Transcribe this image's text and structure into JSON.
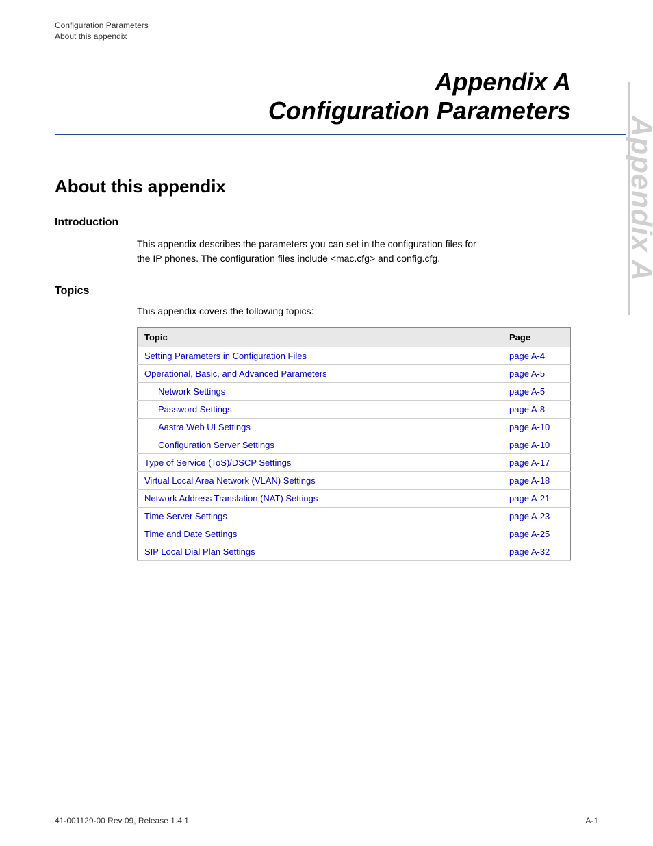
{
  "breadcrumb": {
    "line1": "Configuration Parameters",
    "line2": "About this appendix"
  },
  "title": {
    "appendix_label": "Appendix A",
    "config_label": "Configuration Parameters"
  },
  "side_tab": {
    "text": "Appendix A"
  },
  "section": {
    "heading": "About this appendix",
    "intro_heading": "Introduction",
    "intro_text_line1": "This appendix describes the parameters you can set in the configuration files for",
    "intro_text_line2": "the IP phones. The configuration files include <mac.cfg> and config.cfg.",
    "topics_heading": "Topics",
    "topics_intro": "This appendix covers the following topics:"
  },
  "table": {
    "col_topic": "Topic",
    "col_page": "Page",
    "rows": [
      {
        "topic": "Setting Parameters in Configuration Files",
        "page": "page A-4",
        "indent": false
      },
      {
        "topic": "Operational, Basic, and Advanced Parameters",
        "page": "page A-5",
        "indent": false
      },
      {
        "topic": "Network Settings",
        "page": "page A-5",
        "indent": true
      },
      {
        "topic": "Password Settings",
        "page": "page A-8",
        "indent": true
      },
      {
        "topic": "Aastra Web UI Settings",
        "page": "page A-10",
        "indent": true
      },
      {
        "topic": "Configuration Server Settings",
        "page": "page A-10",
        "indent": true
      },
      {
        "topic": "Type of Service (ToS)/DSCP Settings",
        "page": "page A-17",
        "indent": false
      },
      {
        "topic": "Virtual Local Area Network (VLAN) Settings",
        "page": "page A-18",
        "indent": false
      },
      {
        "topic": "Network Address Translation (NAT) Settings",
        "page": "page A-21",
        "indent": false
      },
      {
        "topic": "Time Server Settings",
        "page": "page A-23",
        "indent": false
      },
      {
        "topic": "Time and Date Settings",
        "page": "page A-25",
        "indent": false
      },
      {
        "topic": "SIP Local Dial Plan Settings",
        "page": "page A-32",
        "indent": false
      }
    ]
  },
  "footer": {
    "left": "41-001129-00 Rev 09, Release 1.4.1",
    "right": "A-1"
  }
}
